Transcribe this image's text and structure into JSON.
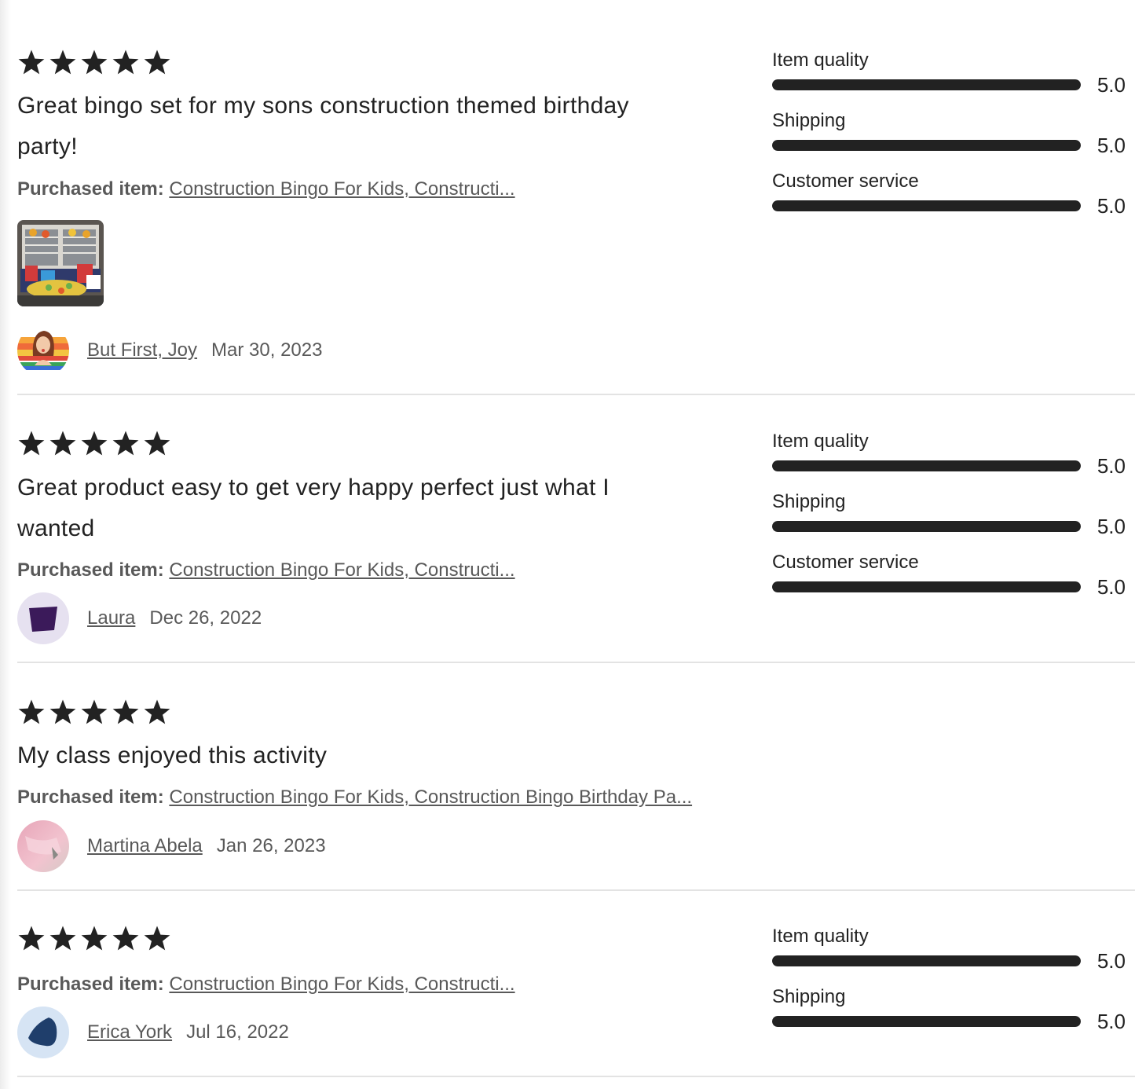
{
  "reviews": [
    {
      "stars": 5,
      "text": "Great bingo set for my sons construction themed birthday party!",
      "purchased_label": "Purchased item:",
      "item": "Construction Bingo For Kids, Constructi...",
      "has_photo": true,
      "reviewer": "But First, Joy",
      "date": "Mar 30, 2023",
      "ratings": [
        {
          "label": "Item quality",
          "value": "5.0",
          "score": 5.0
        },
        {
          "label": "Shipping",
          "value": "5.0",
          "score": 5.0
        },
        {
          "label": "Customer service",
          "value": "5.0",
          "score": 5.0
        }
      ]
    },
    {
      "stars": 5,
      "text": "Great product easy to get very happy perfect just what I wanted",
      "purchased_label": "Purchased item:",
      "item": "Construction Bingo For Kids, Constructi...",
      "reviewer": "Laura",
      "date": "Dec 26, 2022",
      "ratings": [
        {
          "label": "Item quality",
          "value": "5.0",
          "score": 5.0
        },
        {
          "label": "Shipping",
          "value": "5.0",
          "score": 5.0
        },
        {
          "label": "Customer service",
          "value": "5.0",
          "score": 5.0
        }
      ]
    },
    {
      "stars": 5,
      "text": "My class enjoyed this activity",
      "purchased_label": "Purchased item:",
      "item": "Construction Bingo For Kids, Construction Bingo Birthday Pa...",
      "reviewer": "Martina Abela",
      "date": "Jan 26, 2023"
    },
    {
      "stars": 5,
      "purchased_label": "Purchased item:",
      "item": "Construction Bingo For Kids, Constructi...",
      "reviewer": "Erica York",
      "date": "Jul 16, 2022",
      "ratings": [
        {
          "label": "Item quality",
          "value": "5.0",
          "score": 5.0
        },
        {
          "label": "Shipping",
          "value": "5.0",
          "score": 5.0
        }
      ]
    }
  ],
  "rating_max": 5,
  "colors": {
    "star": "#222222",
    "bar_fill": "#222222",
    "text_muted": "#595959"
  },
  "icons": {
    "star": "star-icon"
  }
}
